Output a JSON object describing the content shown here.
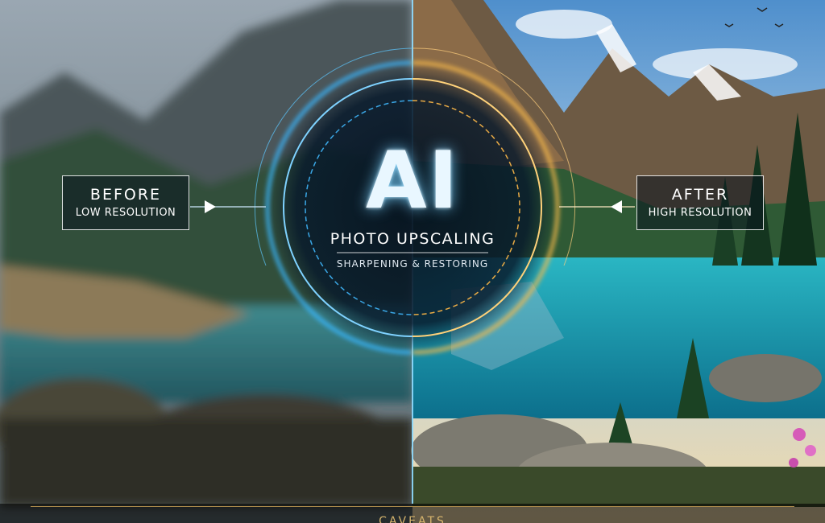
{
  "before": {
    "heading": "BEFORE",
    "sub": "LOW RESOLUTION"
  },
  "after": {
    "heading": "AFTER",
    "sub": "HIGH RESOLUTION"
  },
  "center": {
    "title": "AI",
    "subtitle": "PHOTO UPSCALING",
    "tagline": "SHARPENING & RESTORING"
  },
  "footer": {
    "label": "CAVEATS"
  },
  "colors": {
    "blue_glow": "#39b6ff",
    "gold_glow": "#f2b64a",
    "lake": "#1aa3b8",
    "sky": "#8fbde0"
  }
}
